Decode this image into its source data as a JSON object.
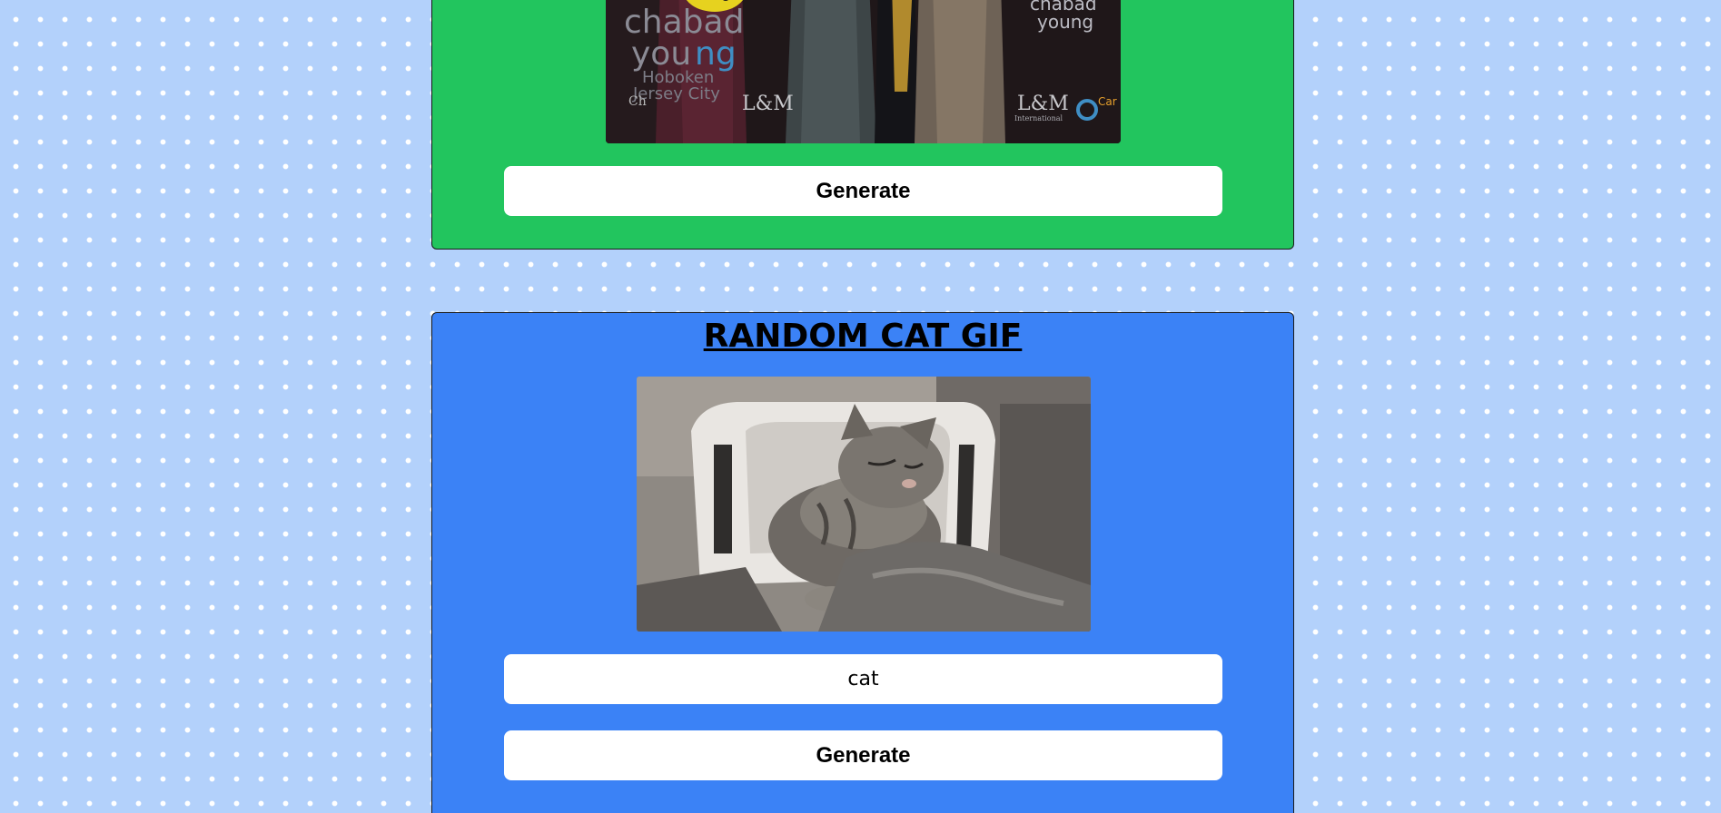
{
  "photo_card": {
    "photo_alt": "Group photo in front of a Chabad Young Hoboken Jersey City backdrop",
    "backdrop_text": [
      "chabad",
      "young",
      "Hoboken",
      "Jersey City",
      "L&M",
      "International"
    ],
    "generate_label": "Generate",
    "background_color": "#22c55e"
  },
  "cat_card": {
    "title": "RANDOM CAT GIF",
    "gif_alt": "Gray tabby cat dozing on a massage chair under a blanket",
    "search_value": "cat",
    "generate_label": "Generate",
    "background_color": "#3b82f6"
  },
  "page": {
    "background_color": "#b3d1fb"
  }
}
